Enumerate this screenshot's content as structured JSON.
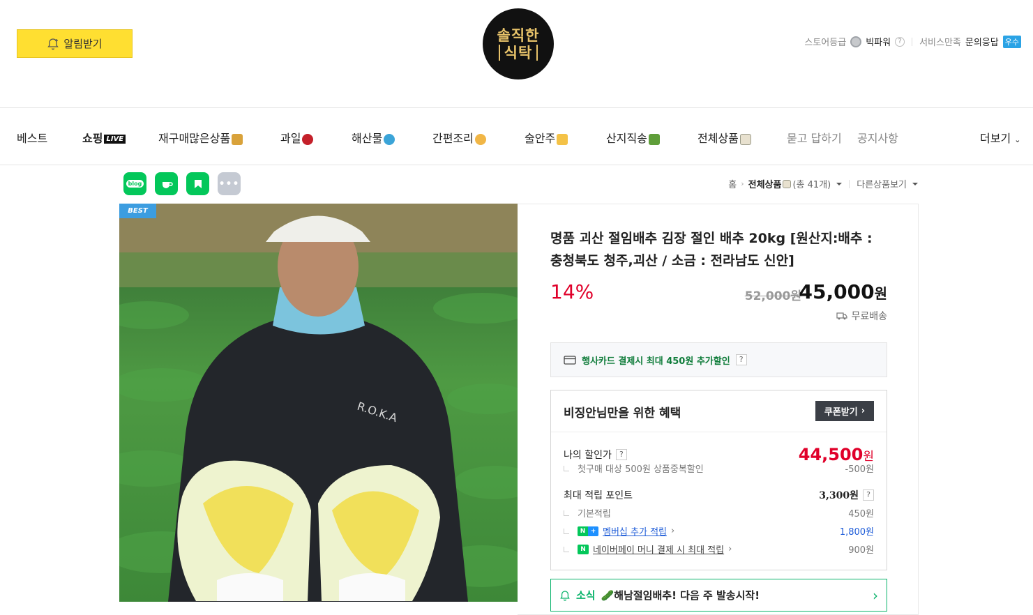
{
  "header": {
    "alarm_label": "알림받기",
    "logo_line1": "솔직한",
    "logo_line2": "식탁",
    "store_grade_label": "스토어등급",
    "store_grade_value": "빅파워",
    "service_label": "서비스만족",
    "service_value": "문의응답",
    "service_badge": "우수"
  },
  "nav": {
    "items": [
      {
        "label": "베스트"
      },
      {
        "label": "쇼핑",
        "tag": "LIVE"
      },
      {
        "label": "재구매많은상품"
      },
      {
        "label": "과일"
      },
      {
        "label": "해산물"
      },
      {
        "label": "간편조리"
      },
      {
        "label": "술안주"
      },
      {
        "label": "산지직송"
      },
      {
        "label": "전체상품"
      },
      {
        "label": "묻고 답하기"
      },
      {
        "label": "공지사항"
      },
      {
        "label": "더보기"
      }
    ]
  },
  "share": {
    "blog_label": "blog"
  },
  "breadcrumb": {
    "home": "홈",
    "category": "전체상품",
    "count": "(총 41개)",
    "other": "다른상품보기"
  },
  "product": {
    "best_tag": "BEST",
    "title": "명품 괴산 절임배추 김장 절인 배추 20kg [원산지:배추 : 충청북도 청주,괴산 / 소금 : 전라남도 신안]",
    "discount": "14%",
    "original_price": "52,000원",
    "price_number": "45,000",
    "price_unit": "원",
    "shipping": "무료배송",
    "shirt_text": "R.O.K.A"
  },
  "card_promo": {
    "text": "행사카드 결제시 최대 450원 추가할인",
    "help": "?"
  },
  "benefit": {
    "title": "비징안님만을 위한 혜택",
    "coupon_label": "쿠폰받기",
    "my_price_label": "나의 할인가",
    "my_price_number": "44,500",
    "my_price_unit": "원",
    "first_purchase": "첫구매 대상 500원 상품중복할인",
    "first_purchase_amount": "-500원",
    "max_points_label": "최대 적립 포인트",
    "max_points_value": "3,300원",
    "basic_label": "기본적립",
    "basic_value": "450원",
    "membership_label": "멤버십 추가 적립",
    "membership_value": "1,800원",
    "npay_label": "네이버페이 머니 결제 시 최대 적립",
    "npay_value": "900원"
  },
  "news": {
    "label": "소식",
    "text": "🥒해남절임배추! 다음 주 발송시작!"
  },
  "colors": {
    "alarm_yellow": "#ffdf31",
    "discount_red": "#e0002a",
    "naver_green": "#03c75a",
    "badge_blue": "#2ba3e5"
  }
}
